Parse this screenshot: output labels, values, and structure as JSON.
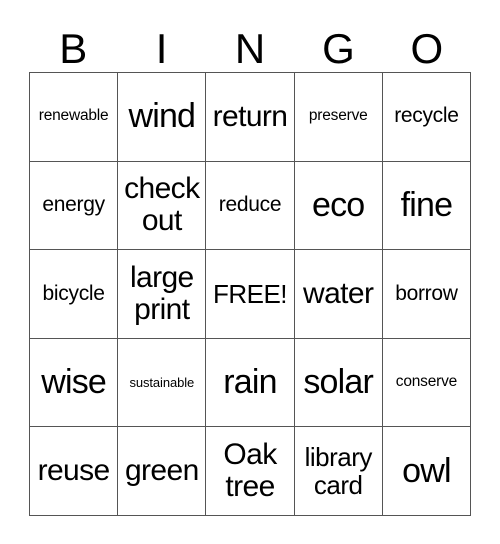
{
  "card": {
    "title": "BINGO",
    "header_letters": [
      "B",
      "I",
      "N",
      "G",
      "O"
    ],
    "free_space_label": "FREE!",
    "colors": {
      "background": "#ffffff",
      "text": "#000000",
      "grid_line": "#555555"
    },
    "rows": [
      [
        {
          "text": "renewable",
          "size": "fs-sm",
          "lines": 1
        },
        {
          "text": "wind",
          "size": "fs-xxl",
          "lines": 1
        },
        {
          "text": "return",
          "size": "fs-xl",
          "lines": 1
        },
        {
          "text": "preserve",
          "size": "fs-sm",
          "lines": 1
        },
        {
          "text": "recycle",
          "size": "fs-md",
          "lines": 1
        }
      ],
      [
        {
          "text": "energy",
          "size": "fs-md",
          "lines": 1
        },
        {
          "text": "check\nout",
          "size": "fs-xl",
          "lines": 2
        },
        {
          "text": "reduce",
          "size": "fs-md",
          "lines": 1
        },
        {
          "text": "eco",
          "size": "fs-xxl",
          "lines": 1
        },
        {
          "text": "fine",
          "size": "fs-xxl",
          "lines": 1
        }
      ],
      [
        {
          "text": "bicycle",
          "size": "fs-md",
          "lines": 1
        },
        {
          "text": "large\nprint",
          "size": "fs-xl",
          "lines": 2
        },
        {
          "text": "FREE!",
          "size": "fs-lg",
          "lines": 1
        },
        {
          "text": "water",
          "size": "fs-xl",
          "lines": 1
        },
        {
          "text": "borrow",
          "size": "fs-md",
          "lines": 1
        }
      ],
      [
        {
          "text": "wise",
          "size": "fs-xxl",
          "lines": 1
        },
        {
          "text": "sustainable",
          "size": "fs-xs",
          "lines": 1
        },
        {
          "text": "rain",
          "size": "fs-xxl",
          "lines": 1
        },
        {
          "text": "solar",
          "size": "fs-xxl",
          "lines": 1
        },
        {
          "text": "conserve",
          "size": "fs-sm",
          "lines": 1
        }
      ],
      [
        {
          "text": "reuse",
          "size": "fs-xl",
          "lines": 1
        },
        {
          "text": "green",
          "size": "fs-xl",
          "lines": 1
        },
        {
          "text": "Oak\ntree",
          "size": "fs-xl",
          "lines": 2
        },
        {
          "text": "library\ncard",
          "size": "fs-lg",
          "lines": 2
        },
        {
          "text": "owl",
          "size": "fs-xxl",
          "lines": 1
        }
      ]
    ]
  }
}
